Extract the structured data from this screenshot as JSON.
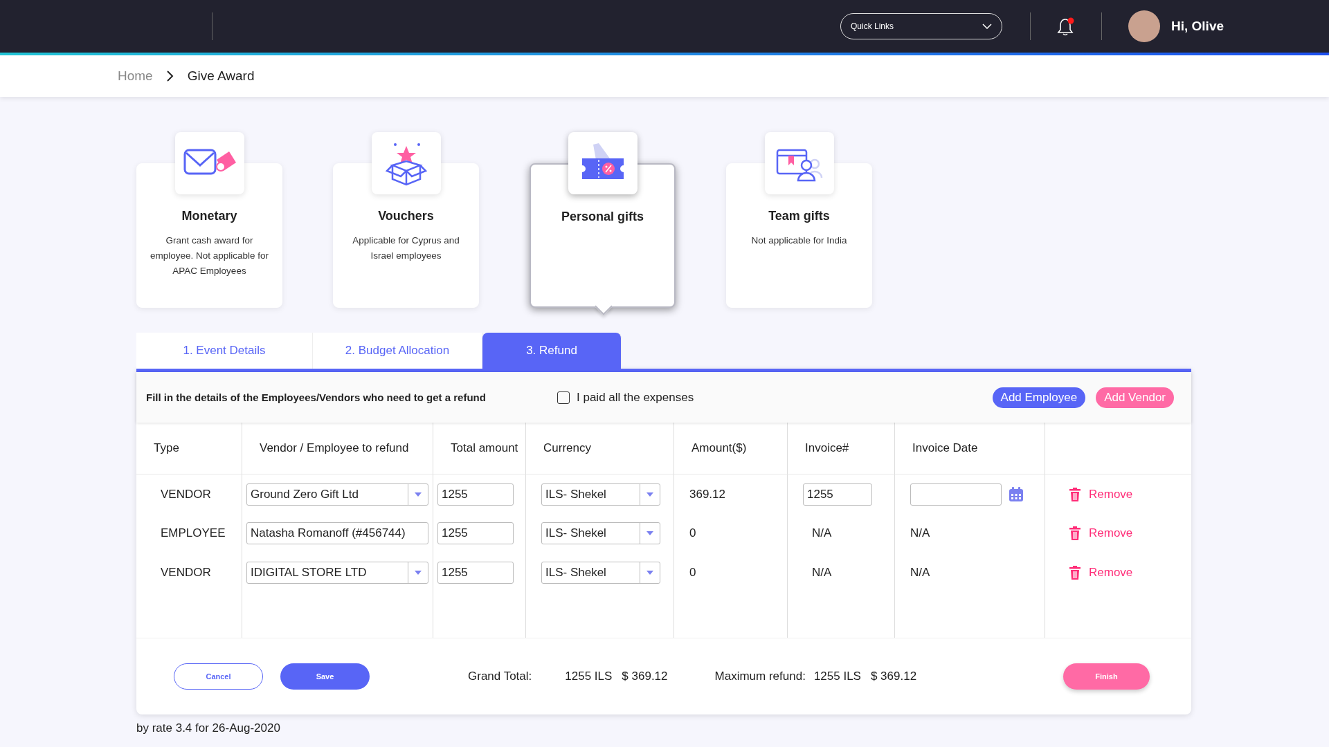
{
  "header": {
    "quick_links": "Quick Links",
    "greeting": "Hi, Olive"
  },
  "breadcrumb": [
    {
      "label": "Home",
      "current": false
    },
    {
      "label": "Give Award",
      "current": true
    }
  ],
  "award_types": [
    {
      "kind": "monetary",
      "title": "Monetary",
      "description": "Grant cash award for employee. Not applicable for APAC Employees",
      "selected": false
    },
    {
      "kind": "vouchers",
      "title": "Vouchers",
      "description": "Applicable for Cyprus and Israel employees",
      "selected": false
    },
    {
      "kind": "personal",
      "title": "Personal gifts",
      "selected": true
    },
    {
      "kind": "team",
      "title": "Team gifts",
      "description": "Not applicable for India",
      "selected": false
    }
  ],
  "tabs": [
    {
      "label": "1. Event Details",
      "selected": false
    },
    {
      "label": "2. Budget Allocation",
      "selected": false
    },
    {
      "label": "3. Refund",
      "selected": true
    }
  ],
  "refund": {
    "instruction": "Fill in the details of the Employees/Vendors who need to get a refund",
    "paid_all": {
      "label": "I paid all the expenses",
      "checked": false
    },
    "buttons": [
      {
        "label": "Add Employee",
        "kind": "primary"
      },
      {
        "label": "Add Vendor",
        "kind": "accent"
      }
    ]
  },
  "table": {
    "columns": [
      "Type",
      "Vendor / Employee to refund",
      "Total amount",
      "Currency",
      "Amount($)",
      "Invoice#",
      "Invoice Date"
    ],
    "rows": [
      {
        "type": "VENDOR",
        "payee": {
          "value": "Ground Zero Gift Ltd",
          "dropdown": true
        },
        "total": "1255",
        "currency": "ILS- Shekel",
        "amount": "369.12",
        "invoice": {
          "kind": "field",
          "value": "1255"
        },
        "invoice_date": {
          "kind": "date-picker"
        },
        "action": "Remove"
      },
      {
        "type": "EMPLOYEE",
        "payee": {
          "value": "Natasha Romanoff (#456744)",
          "dropdown": false
        },
        "total": "1255",
        "currency": "ILS- Shekel",
        "amount": "0",
        "invoice": {
          "kind": "text",
          "value": "N/A"
        },
        "invoice_date": {
          "kind": "text",
          "value": "N/A"
        },
        "action": "Remove"
      },
      {
        "type": "VENDOR",
        "payee": {
          "value": "IDIGITAL STORE LTD",
          "dropdown": true
        },
        "total": "1255",
        "currency": "ILS- Shekel",
        "amount": "0",
        "invoice": {
          "kind": "text",
          "value": "N/A"
        },
        "invoice_date": {
          "kind": "text",
          "value": "N/A"
        },
        "action": "Remove"
      }
    ]
  },
  "footer": {
    "buttons": [
      {
        "label": "Cancel",
        "kind": "outline"
      },
      {
        "label": "Save",
        "kind": "primary"
      }
    ],
    "grand_total": {
      "label": "Grand Total:",
      "ils": "1255 ILS",
      "usd": "$ 369.12"
    },
    "maximum_refund": {
      "label": "Maximum refund:",
      "ils": "1255 ILS",
      "usd": "$ 369.12"
    },
    "finish": "Finish"
  },
  "note": "by rate 3.4 for 26-Aug-2020"
}
